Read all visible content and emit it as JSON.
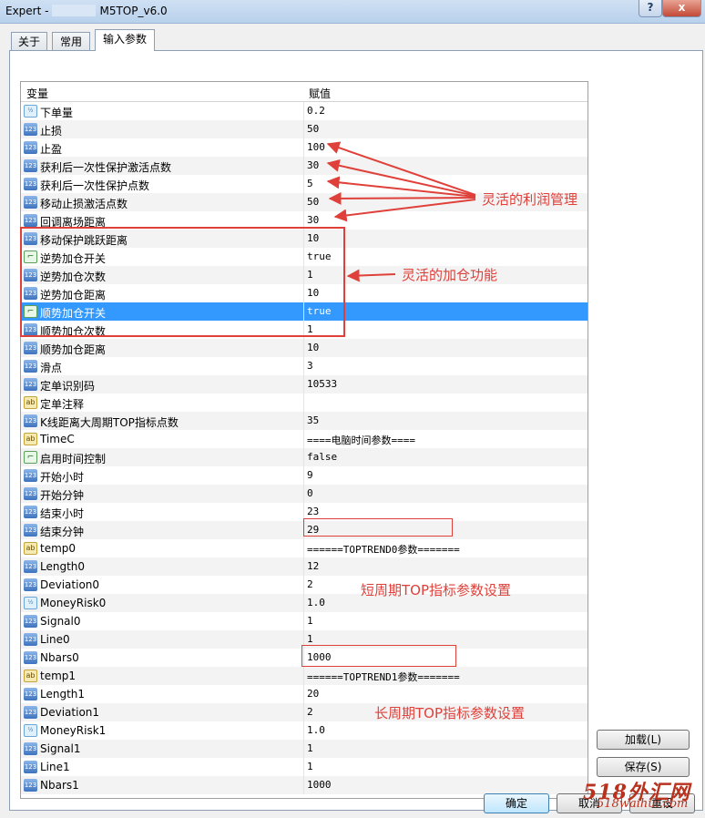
{
  "window": {
    "title_prefix": "Expert -",
    "title_suffix": "M5TOP_v6.0",
    "help_label": "?",
    "close_label": "x"
  },
  "tabs": [
    {
      "label": "关于",
      "active": false
    },
    {
      "label": "常用",
      "active": false
    },
    {
      "label": "输入参数",
      "active": true
    }
  ],
  "grid": {
    "col_variable": "变量",
    "col_value": "赋值",
    "rows": [
      {
        "name": "下单量",
        "value": "0.2",
        "type": "dbl"
      },
      {
        "name": "止损",
        "value": "50",
        "type": "int"
      },
      {
        "name": "止盈",
        "value": "100",
        "type": "int"
      },
      {
        "name": "获利后一次性保护激活点数",
        "value": "30",
        "type": "int"
      },
      {
        "name": "获利后一次性保护点数",
        "value": "5",
        "type": "int"
      },
      {
        "name": "移动止损激活点数",
        "value": "50",
        "type": "int"
      },
      {
        "name": "回调离场距离",
        "value": "30",
        "type": "int"
      },
      {
        "name": "移动保护跳跃距离",
        "value": "10",
        "type": "int"
      },
      {
        "name": "逆势加仓开关",
        "value": "true",
        "type": "bool"
      },
      {
        "name": "逆势加仓次数",
        "value": "1",
        "type": "int"
      },
      {
        "name": "逆势加仓距离",
        "value": "10",
        "type": "int"
      },
      {
        "name": "顺势加仓开关",
        "value": "true",
        "type": "bool",
        "selected": true
      },
      {
        "name": "顺势加仓次数",
        "value": "1",
        "type": "int"
      },
      {
        "name": "顺势加仓距离",
        "value": "10",
        "type": "int"
      },
      {
        "name": "滑点",
        "value": "3",
        "type": "int"
      },
      {
        "name": "定单识别码",
        "value": "10533",
        "type": "int"
      },
      {
        "name": "定单注释",
        "value": "",
        "type": "str"
      },
      {
        "name": "K线距离大周期TOP指标点数",
        "value": "35",
        "type": "int"
      },
      {
        "name": "TimeC",
        "value": "====电脑时间参数====",
        "type": "str"
      },
      {
        "name": "启用时间控制",
        "value": "false",
        "type": "bool"
      },
      {
        "name": "开始小时",
        "value": "9",
        "type": "int"
      },
      {
        "name": "开始分钟",
        "value": "0",
        "type": "int"
      },
      {
        "name": "结束小时",
        "value": "23",
        "type": "int"
      },
      {
        "name": "结束分钟",
        "value": "29",
        "type": "int"
      },
      {
        "name": "temp0",
        "value": "======TOPTREND0参数=======",
        "type": "str"
      },
      {
        "name": "Length0",
        "value": "12",
        "type": "int"
      },
      {
        "name": "Deviation0",
        "value": "2",
        "type": "int"
      },
      {
        "name": "MoneyRisk0",
        "value": "1.0",
        "type": "dbl"
      },
      {
        "name": "Signal0",
        "value": "1",
        "type": "int"
      },
      {
        "name": "Line0",
        "value": "1",
        "type": "int"
      },
      {
        "name": "Nbars0",
        "value": "1000",
        "type": "int"
      },
      {
        "name": "temp1",
        "value": "======TOPTREND1参数=======",
        "type": "str"
      },
      {
        "name": "Length1",
        "value": "20",
        "type": "int"
      },
      {
        "name": "Deviation1",
        "value": "2",
        "type": "int"
      },
      {
        "name": "MoneyRisk1",
        "value": "1.0",
        "type": "dbl"
      },
      {
        "name": "Signal1",
        "value": "1",
        "type": "int"
      },
      {
        "name": "Line1",
        "value": "1",
        "type": "int"
      },
      {
        "name": "Nbars1",
        "value": "1000",
        "type": "int"
      }
    ]
  },
  "icons": {
    "int": "123",
    "dbl": "½",
    "bool": "⌐",
    "str": "ab"
  },
  "buttons": {
    "load": "加载(L)",
    "save": "保存(S)",
    "ok": "确定",
    "cancel": "取消",
    "reset": "重设"
  },
  "annotations": {
    "profit_mgmt": "灵活的利润管理",
    "add_position": "灵活的加仓功能",
    "short_period": "短周期TOP指标参数设置",
    "long_period": "长周期TOP指标参数设置",
    "color": "#e0403a"
  },
  "watermark": {
    "brand": "518外汇网",
    "url": "518waihui.com"
  }
}
